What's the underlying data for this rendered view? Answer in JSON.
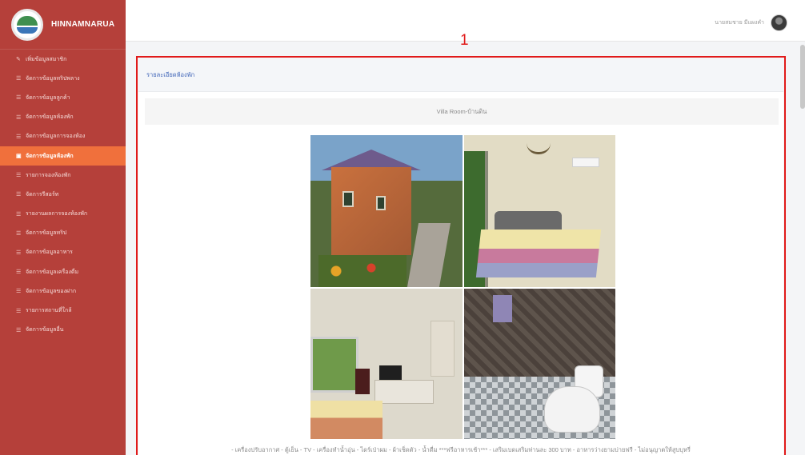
{
  "brand": {
    "name": "HINNAMNARUA",
    "logo_icon": "resort-logo-icon"
  },
  "sidebar": {
    "items": [
      {
        "label": "เพิ่มข้อมูลสมาชิก",
        "icon": "pencil-icon",
        "active": false
      },
      {
        "label": "จัดการข้อมูลทริปพลาง",
        "icon": "list-icon",
        "active": false
      },
      {
        "label": "จัดการข้อมูลลูกค้า",
        "icon": "list-icon",
        "active": false
      },
      {
        "label": "จัดการข้อมูลห้องพัก",
        "icon": "list-icon",
        "active": false
      },
      {
        "label": "จัดการข้อมูลการจองห้อง",
        "icon": "list-icon",
        "active": false
      },
      {
        "label": "จัดการข้อมูลห้องพัก",
        "icon": "bed-icon",
        "active": true
      },
      {
        "label": "รายการจองห้องพัก",
        "icon": "list-icon",
        "active": false
      },
      {
        "label": "จัดการรีสอร์ท",
        "icon": "list-icon",
        "active": false
      },
      {
        "label": "รายงานผลการจองห้องพัก",
        "icon": "list-icon",
        "active": false
      },
      {
        "label": "จัดการข้อมูลทริป",
        "icon": "list-icon",
        "active": false
      },
      {
        "label": "จัดการข้อมูลอาหาร",
        "icon": "list-icon",
        "active": false
      },
      {
        "label": "จัดการข้อมูลเครื่องดื่ม",
        "icon": "list-icon",
        "active": false
      },
      {
        "label": "จัดการข้อมูลของฝาก",
        "icon": "list-icon",
        "active": false
      },
      {
        "label": "รายการสถานที่ใกล้",
        "icon": "list-icon",
        "active": false
      },
      {
        "label": "จัดการข้อมูลอื่น",
        "icon": "list-icon",
        "active": false
      }
    ]
  },
  "topbar": {
    "username": "นายสมชาย มีแผงคำ",
    "avatar_icon": "user-avatar-icon"
  },
  "annotation": {
    "label": "1",
    "color": "#e11a1a"
  },
  "card": {
    "title": "รายละเอียดห้องพัก",
    "room_title": "Villa Room-บ้านดิน",
    "photos": [
      {
        "name": "exterior-photo"
      },
      {
        "name": "bedroom-photo"
      },
      {
        "name": "room-interior-photo"
      },
      {
        "name": "bathroom-photo"
      }
    ],
    "amenities": "- เครื่องปรับอากาศ - ตู้เย็น - TV - เครื่องทำน้ำอุ่น - ไดร์เป่าผม - ผ้าเช็ดตัว - น้ำดื่ม ***ฟรีอาหารเช้า*** - เสริมเบดเสริมท่านละ 300 บาท - อาหารว่างยามบ่ายฟรี - ไม่อนุญาตให้สูบบุหรี่"
  },
  "colors": {
    "sidebar_bg": "#b5403a",
    "sidebar_active": "#f0703c",
    "card_title": "#3d63b7",
    "highlight": "#e11a1a"
  }
}
